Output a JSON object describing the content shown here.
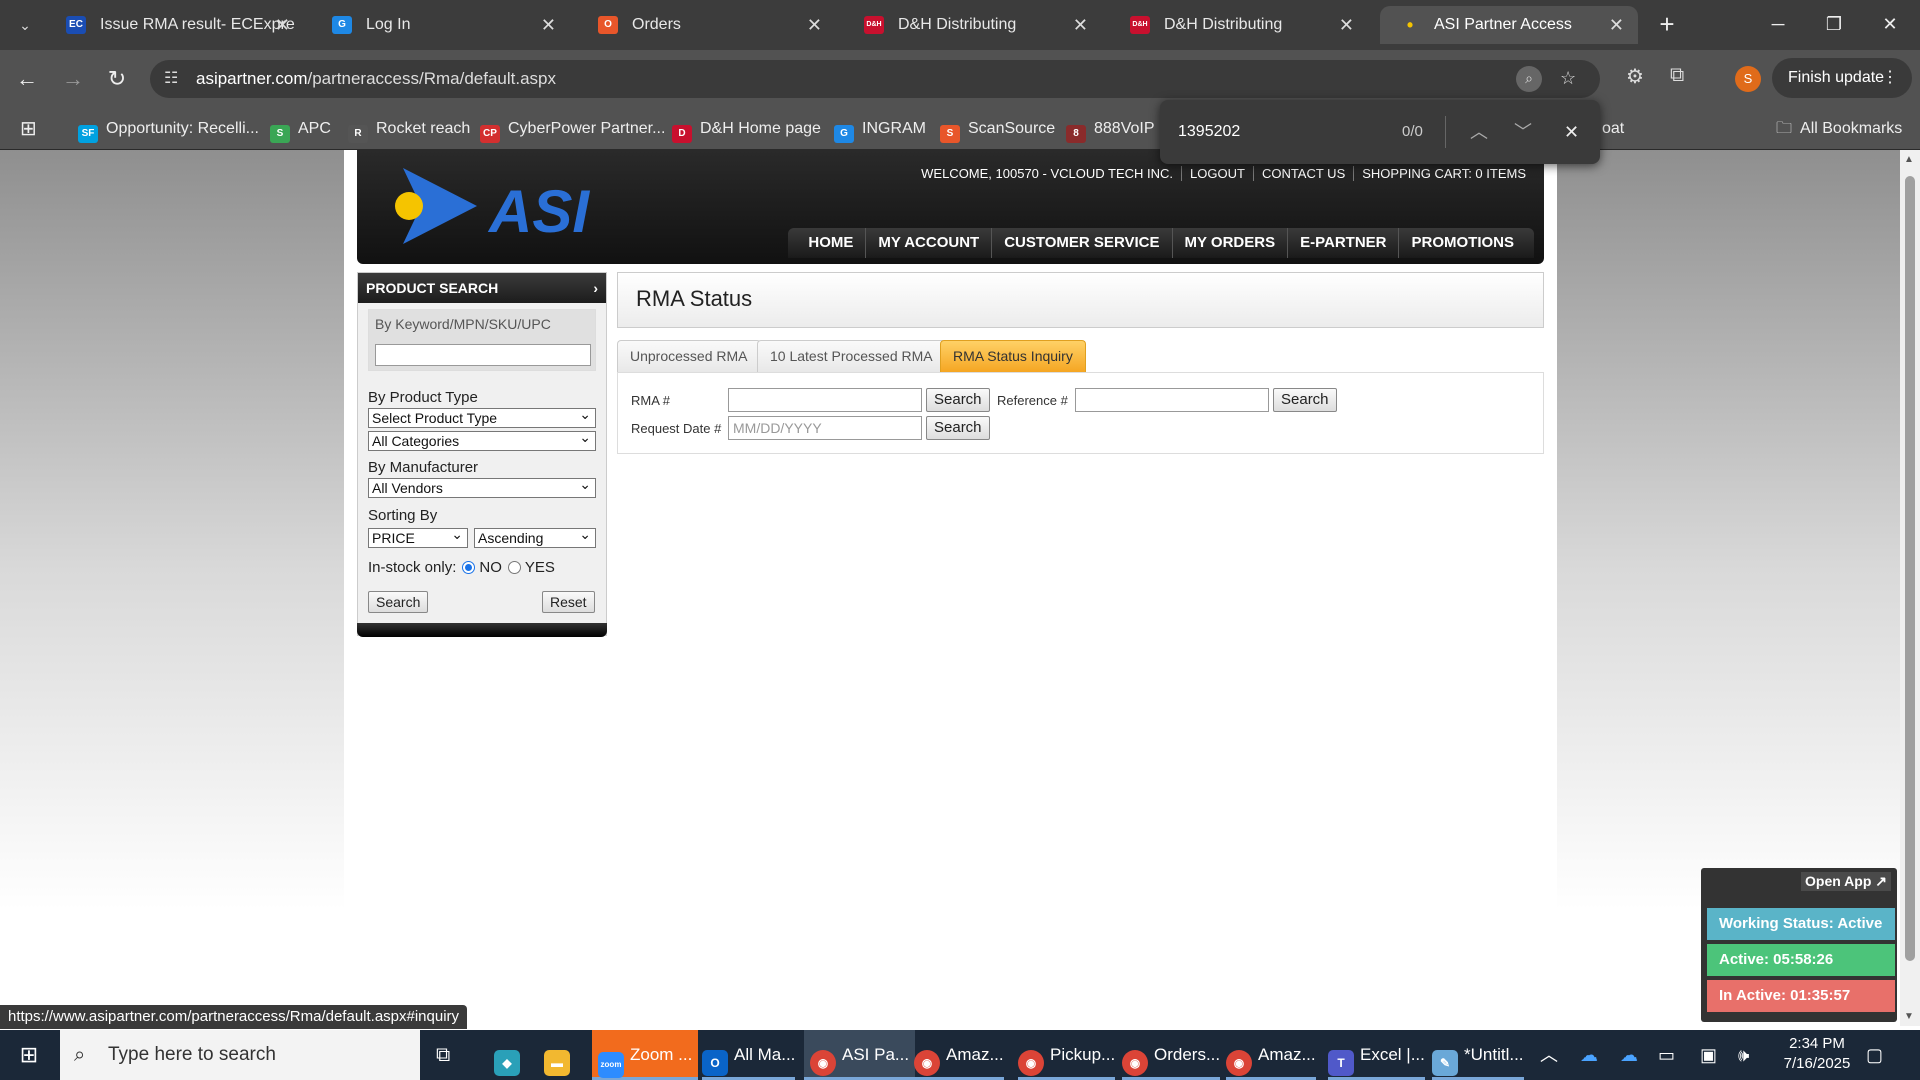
{
  "browser": {
    "tabs": [
      {
        "title": "Issue RMA result- ECExpre",
        "favicon": "EC",
        "color": "#1a4db3"
      },
      {
        "title": "Log In",
        "favicon": "G",
        "color": "#1e88e5"
      },
      {
        "title": "Orders",
        "favicon": "O",
        "color": "#e8562a"
      },
      {
        "title": "D&H Distributing",
        "favicon": "D&H",
        "color": "#c8102e"
      },
      {
        "title": "D&H Distributing",
        "favicon": "D&H",
        "color": "#c8102e"
      },
      {
        "title": "ASI Partner Access",
        "favicon": "•",
        "color": "#f5c400"
      }
    ],
    "url_domain": "asipartner.com",
    "url_path": "/partneraccess/Rma/default.aspx",
    "finish_update": "Finish update",
    "profile_initial": "S",
    "bookmarks": [
      {
        "label": "Opportunity: Recelli...",
        "icon": "SF",
        "color": "#00a1e0"
      },
      {
        "label": "APC",
        "icon": "S",
        "color": "#3aa655"
      },
      {
        "label": "Rocket reach",
        "icon": "R",
        "color": "#555"
      },
      {
        "label": "CyberPower Partner...",
        "icon": "CP",
        "color": "#d32f2f"
      },
      {
        "label": "D&H Home page",
        "icon": "D",
        "color": "#c8102e"
      },
      {
        "label": "INGRAM",
        "icon": "G",
        "color": "#1e88e5"
      },
      {
        "label": "ScanSource",
        "icon": "S",
        "color": "#e8562a"
      },
      {
        "label": "888VoIP",
        "icon": "8",
        "color": "#8a2b2b"
      },
      {
        "label": "oat",
        "icon": "",
        "color": ""
      }
    ],
    "all_bookmarks": "All Bookmarks",
    "find": {
      "query": "1395202",
      "count": "0/0"
    },
    "status_url": "https://www.asipartner.com/partneraccess/Rma/default.aspx#inquiry"
  },
  "site": {
    "logo_text": "ASI",
    "top_links": [
      "WELCOME, 100570 - VCLOUD TECH INC.",
      "LOGOUT",
      "CONTACT US",
      "SHOPPING CART: 0 ITEMS"
    ],
    "nav": [
      "HOME",
      "MY ACCOUNT",
      "CUSTOMER SERVICE",
      "MY ORDERS",
      "E-PARTNER",
      "PROMOTIONS"
    ]
  },
  "product_search": {
    "title": "PRODUCT SEARCH",
    "keyword_label": "By Keyword/MPN/SKU/UPC",
    "keyword_value": "",
    "product_type_label": "By Product Type",
    "product_type_value": "Select Product Type",
    "category_value": "All Categories",
    "manufacturer_label": "By Manufacturer",
    "manufacturer_value": "All Vendors",
    "sorting_label": "Sorting By",
    "sort_field": "PRICE",
    "sort_order": "Ascending",
    "instock_label": "In-stock only:",
    "instock_no": "NO",
    "instock_yes": "YES",
    "search_btn": "Search",
    "reset_btn": "Reset"
  },
  "rma": {
    "title": "RMA Status",
    "tabs": [
      "Unprocessed RMA",
      "10 Latest Processed RMA",
      "RMA Status Inquiry"
    ],
    "rma_label": "RMA #",
    "reference_label": "Reference #",
    "request_date_label": "Request Date #",
    "date_placeholder": "MM/DD/YYYY",
    "search_btn": "Search"
  },
  "widget": {
    "open_app": "Open App ↗",
    "working_status": "Working Status: Active",
    "active": "Active: 05:58:26",
    "inactive": "In Active: 01:35:57",
    "colors": {
      "working": "#5ab4c8",
      "active": "#4cc47a",
      "inactive": "#e8706a"
    }
  },
  "taskbar": {
    "search_placeholder": "Type here to search",
    "apps": [
      "Zoom ...",
      "All Ma...",
      "ASI Pa...",
      "Amaz...",
      "Pickup...",
      "Orders...",
      "Amaz...",
      "Excel |...",
      "*Untitl..."
    ],
    "time": "2:34 PM",
    "date": "7/16/2025"
  }
}
